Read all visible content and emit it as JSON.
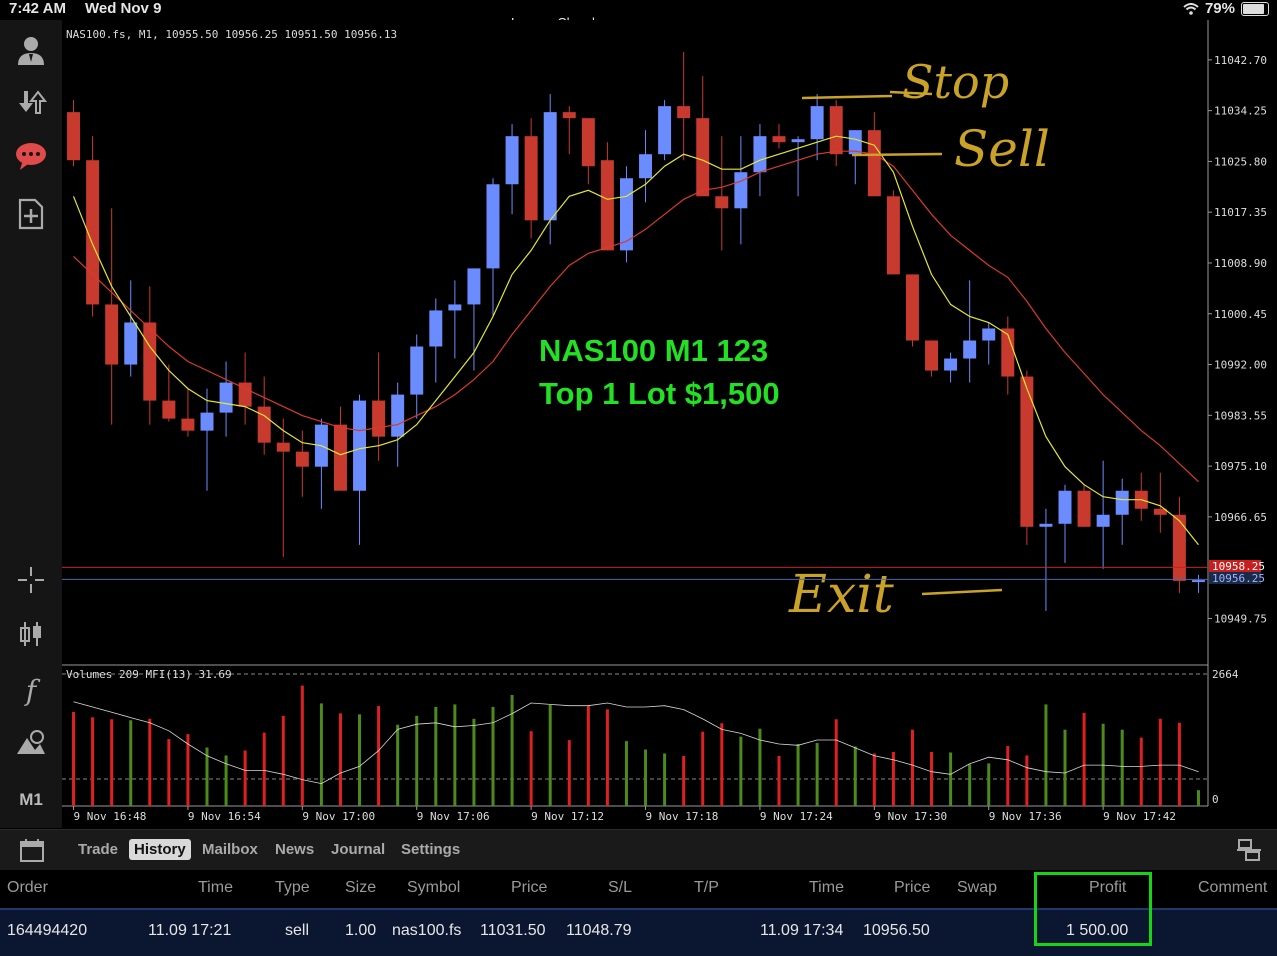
{
  "status_bar": {
    "time": "7:42 AM",
    "date": "Wed Nov 9",
    "wifi_icon": "wifi-icon",
    "battery": "79%",
    "battery_level": 0.79
  },
  "account_name": "Lennox Chambers",
  "sidebar": {
    "items": [
      {
        "icon": "account-icon"
      },
      {
        "icon": "deposit-icon"
      },
      {
        "icon": "chat-icon",
        "color": "#e04a4a"
      },
      {
        "icon": "new-order-icon"
      },
      {
        "icon": "crosshair-icon"
      },
      {
        "icon": "chart-type-icon"
      },
      {
        "icon": "indicators-icon",
        "label": "f"
      },
      {
        "icon": "objects-icon"
      },
      {
        "icon": "timeframe-icon",
        "label": "M1"
      }
    ]
  },
  "chart": {
    "header": "NAS100.fs, M1, 10955.50 10956.25 10951.50 10956.13",
    "volume_header": "Volumes 209 MFI(13) 31.69",
    "annotation_line1": "NAS100 M1 123",
    "annotation_line2": "Top 1 Lot $1,500",
    "annotation_color": "#22e022",
    "handwritten": {
      "stop": "Stop",
      "sell": "Sell",
      "exit": "Exit",
      "color": "#c9a227"
    },
    "bid_label": "10958.25",
    "ask_label": "10956.25",
    "volume_max_label": "2664",
    "volume_min_label": "0",
    "colors": {
      "bull": "#6b8cff",
      "bear": "#c83a2e",
      "fast_ma": "#e6e633",
      "slow_ma": "#d83a2e",
      "vol_up": "#4d8a1e",
      "vol_down": "#e02020"
    }
  },
  "chart_data": {
    "type": "candlestick",
    "symbol": "NAS100.fs",
    "timeframe": "M1",
    "y_ticks": [
      "11042.70",
      "11034.25",
      "11025.80",
      "11017.35",
      "11008.90",
      "11000.45",
      "10992.00",
      "10983.55",
      "10975.10",
      "10966.65",
      "10949.75"
    ],
    "x_ticks": [
      "9 Nov 16:48",
      "9 Nov 16:54",
      "9 Nov 17:00",
      "9 Nov 17:06",
      "9 Nov 17:12",
      "9 Nov 17:18",
      "9 Nov 17:24",
      "9 Nov 17:30",
      "9 Nov 17:36",
      "9 Nov 17:42"
    ],
    "ylim": [
      10942.5,
      11049.0
    ],
    "candles": [
      [
        11034.0,
        11036.0,
        11025.0,
        11026.0
      ],
      [
        11026.0,
        11030.0,
        11000.0,
        11002.0
      ],
      [
        11002.0,
        11018.0,
        10982.0,
        10992.0
      ],
      [
        10992.0,
        11006.0,
        10990.0,
        10999.0
      ],
      [
        10999.0,
        11005.0,
        10982.0,
        10986.0
      ],
      [
        10986.0,
        10992.0,
        10982.5,
        10983.0
      ],
      [
        10983.0,
        10988.0,
        10980.0,
        10981.0
      ],
      [
        10981.0,
        10988.0,
        10971.0,
        10984.0
      ],
      [
        10984.0,
        10992.5,
        10980.0,
        10989.0
      ],
      [
        10989.0,
        10994.0,
        10982.0,
        10985.0
      ],
      [
        10985.0,
        10990.0,
        10977.0,
        10979.0
      ],
      [
        10979.0,
        10983.0,
        10960.0,
        10977.5
      ],
      [
        10977.5,
        10981.0,
        10970.0,
        10975.0
      ],
      [
        10975.0,
        10983.0,
        10968.0,
        10982.0
      ],
      [
        10982.0,
        10985.0,
        10972.0,
        10971.0
      ],
      [
        10971.0,
        10987.0,
        10962.0,
        10986.0
      ],
      [
        10986.0,
        10994.0,
        10976.0,
        10980.0
      ],
      [
        10980.0,
        10989.0,
        10975.0,
        10987.0
      ],
      [
        10987.0,
        10997.0,
        10983.0,
        10995.0
      ],
      [
        10995.0,
        11003.0,
        10989.0,
        11001.0
      ],
      [
        11001.0,
        11006.0,
        10993.0,
        11002.0
      ],
      [
        11002.0,
        11008.0,
        10991.0,
        11008.0
      ],
      [
        11008.0,
        11023.0,
        11000.0,
        11022.0
      ],
      [
        11022.0,
        11032.0,
        11017.0,
        11030.0
      ],
      [
        11030.0,
        11033.0,
        11013.0,
        11016.0
      ],
      [
        11016.0,
        11037.0,
        11012.0,
        11034.0
      ],
      [
        11034.0,
        11035.0,
        11027.0,
        11033.0
      ],
      [
        11033.0,
        11030.0,
        11022.0,
        11025.0
      ],
      [
        11026.0,
        11029.0,
        11011.0,
        11011.0
      ],
      [
        11011.0,
        11025.0,
        11009.0,
        11023.0
      ],
      [
        11023.0,
        11031.0,
        11019.0,
        11027.0
      ],
      [
        11027.0,
        11036.0,
        11026.0,
        11035.0
      ],
      [
        11035.0,
        11044.0,
        11026.0,
        11033.0
      ],
      [
        11033.0,
        11040.0,
        11024.0,
        11020.0
      ],
      [
        11020.0,
        11030.0,
        11011.0,
        11018.0
      ],
      [
        11018.0,
        11030.0,
        11012.0,
        11024.0
      ],
      [
        11024.0,
        11032.0,
        11020.0,
        11030.0
      ],
      [
        11030.0,
        11032.0,
        11028.0,
        11029.0
      ],
      [
        11029.0,
        11030.0,
        11020.0,
        11029.5
      ],
      [
        11029.5,
        11037.0,
        11026.0,
        11035.0
      ],
      [
        11035.0,
        11036.0,
        11025.0,
        11027.0
      ],
      [
        11027.0,
        11031.0,
        11022.0,
        11031.0
      ],
      [
        11031.0,
        11034.0,
        11021.0,
        11020.0
      ],
      [
        11020.0,
        11021.0,
        11007.0,
        11007.0
      ],
      [
        11007.0,
        11007.0,
        10995.0,
        10996.0
      ],
      [
        10996.0,
        10996.0,
        10990.0,
        10991.0
      ],
      [
        10991.0,
        10994.0,
        10989.0,
        10993.0
      ],
      [
        10993.0,
        11006.0,
        10989.0,
        10996.0
      ],
      [
        10996.0,
        10999.0,
        10992.0,
        10998.0
      ],
      [
        10998.0,
        11000.0,
        10987.0,
        10990.0
      ],
      [
        10990.0,
        10991.0,
        10962.0,
        10965.0
      ],
      [
        10965.0,
        10968.0,
        10951.0,
        10965.5
      ],
      [
        10965.5,
        10972.0,
        10959.0,
        10971.0
      ],
      [
        10971.0,
        10972.0,
        10965.0,
        10965.0
      ],
      [
        10965.0,
        10976.0,
        10958.0,
        10967.0
      ],
      [
        10967.0,
        10973.0,
        10962.0,
        10971.0
      ],
      [
        10971.0,
        10974.0,
        10966.0,
        10968.0
      ],
      [
        10968.0,
        10974.0,
        10964.0,
        10967.0
      ],
      [
        10967.0,
        10970.0,
        10954.0,
        10956.0
      ],
      [
        10956.0,
        10957.0,
        10954.0,
        10956.13
      ]
    ],
    "fast_ma": [
      11020,
      11012,
      11005,
      11000,
      10995,
      10991,
      10988,
      10986,
      10985.5,
      10985,
      10983.5,
      10981,
      10979,
      10978.5,
      10977,
      10978,
      10978.5,
      10979.5,
      10982,
      10986,
      10990,
      10994,
      11000,
      11007,
      11011,
      11016,
      11020,
      11021,
      11019.5,
      11020,
      11022,
      11025,
      11027,
      11026,
      11024.5,
      11024.5,
      11026,
      11027,
      11028,
      11029,
      11030,
      11029.5,
      11028.5,
      11024,
      11015,
      11007,
      11002,
      11000,
      10999,
      10997,
      10988,
      10980,
      10975,
      10972,
      10970,
      10969.5,
      10969.5,
      10968.5,
      10966,
      10962
    ],
    "slow_ma": [
      11010,
      11007,
      11004,
      11001,
      10998,
      10995,
      10992.5,
      10991,
      10989.5,
      10988,
      10986.5,
      10985,
      10983.5,
      10982.5,
      10981.5,
      10981,
      10981.5,
      10982,
      10983.5,
      10985,
      10987,
      10989.5,
      10992.5,
      10997,
      11001,
      11005,
      11008.5,
      11010.5,
      11011.5,
      11012.5,
      11014.5,
      11017,
      11019.5,
      11021,
      11021.5,
      11022.5,
      11024,
      11025,
      11026,
      11027,
      11027.5,
      11027.5,
      11027,
      11025,
      11021,
      11017,
      11013.5,
      11011,
      11008.5,
      11006.5,
      11002.5,
      10998,
      10994,
      10990.5,
      10987,
      10984,
      10981,
      10978.5,
      10975.5,
      10972.5
    ],
    "volumes": [
      1900,
      1790,
      1750,
      1730,
      1760,
      1350,
      1450,
      1180,
      1020,
      1120,
      1480,
      1820,
      2430,
      2070,
      1870,
      1850,
      2020,
      1640,
      1820,
      2000,
      2050,
      1760,
      2000,
      2240,
      1510,
      2040,
      1330,
      2020,
      1950,
      1310,
      1140,
      1060,
      1010,
      1500,
      1670,
      1400,
      1560,
      1010,
      1250,
      1270,
      1750,
      1200,
      1060,
      1090,
      1540,
      1090,
      1080,
      840,
      860,
      1210,
      1020,
      2050,
      1540,
      1880,
      1660,
      1540,
      1380,
      1760,
      1680,
      320
    ],
    "mfi": [
      79,
      75,
      71,
      67,
      63,
      57,
      47,
      38,
      32,
      27,
      27,
      24,
      20,
      17,
      25,
      30,
      42,
      58,
      62,
      63,
      60,
      61,
      63,
      70,
      78,
      77,
      76,
      76,
      78,
      75,
      75,
      76,
      73,
      66,
      58,
      55,
      50,
      47,
      46,
      50,
      50,
      44,
      38,
      35,
      31,
      26,
      24,
      32,
      37,
      35,
      29,
      26,
      25,
      31,
      31,
      30,
      30,
      31,
      31,
      26
    ],
    "bid": 10958.25,
    "ask": 10956.25
  },
  "tabs": [
    {
      "label": "Trade",
      "active": false
    },
    {
      "label": "History",
      "active": true
    },
    {
      "label": "Mailbox",
      "active": false
    },
    {
      "label": "News",
      "active": false
    },
    {
      "label": "Journal",
      "active": false
    },
    {
      "label": "Settings",
      "active": false
    }
  ],
  "history_table": {
    "columns": [
      "Order",
      "Time",
      "Type",
      "Size",
      "Symbol",
      "Price",
      "S/L",
      "T/P",
      "Time",
      "Price",
      "Swap",
      "Profit",
      "Comment"
    ],
    "rows": [
      {
        "order": "164494420",
        "open_time": "11.09 17:21",
        "type": "sell",
        "size": "1.00",
        "symbol": "nas100.fs",
        "open_price": "11031.50",
        "sl": "11048.79",
        "tp": "",
        "close_time": "11.09 17:34",
        "close_price": "10956.50",
        "swap": "",
        "profit": "1 500.00",
        "comment": ""
      }
    ],
    "highlight_color": "#18d418"
  }
}
